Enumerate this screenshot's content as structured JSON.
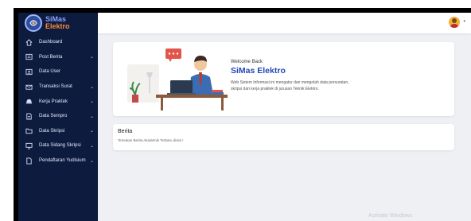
{
  "brand": {
    "line1": "SiMas",
    "line2": "Elektro"
  },
  "sidebar": {
    "items": [
      {
        "label": "Dashboard",
        "icon": "home-icon",
        "has_submenu": false
      },
      {
        "label": "Post Berita",
        "icon": "newspaper-icon",
        "has_submenu": true
      },
      {
        "label": "Data User",
        "icon": "user-card-icon",
        "has_submenu": false
      },
      {
        "label": "Transaksi Surat",
        "icon": "mail-icon",
        "has_submenu": true
      },
      {
        "label": "Kerja Praktek",
        "icon": "helmet-icon",
        "has_submenu": true
      },
      {
        "label": "Data Sempro",
        "icon": "document-icon",
        "has_submenu": true
      },
      {
        "label": "Data Skripsi",
        "icon": "folder-icon",
        "has_submenu": true
      },
      {
        "label": "Data Sidang Skripsi",
        "icon": "monitor-icon",
        "has_submenu": true
      },
      {
        "label": "Pendaftaran Yudisium",
        "icon": "file-icon",
        "has_submenu": true
      }
    ],
    "chevron": "⌄"
  },
  "topbar": {
    "avatar_icon": "user-avatar-icon",
    "caret": "▾"
  },
  "welcome": {
    "greeting": "Welcome Back",
    "title": "SiMas Elektro",
    "description_line1": "Web Sistem Informasi ini mengatur dan mengolah data persuratan,",
    "description_line2": "skripsi dan kerja praktek di jurusan Teknik Elektro."
  },
  "berita": {
    "title": "Berita",
    "subtitle": "Temukan Berita Akademik Terbaru disini !"
  },
  "watermark": "Activate Windows",
  "colors": {
    "sidebar_bg": "#0d1b3e",
    "accent": "#2447b8",
    "content_bg": "#eef0f4"
  }
}
